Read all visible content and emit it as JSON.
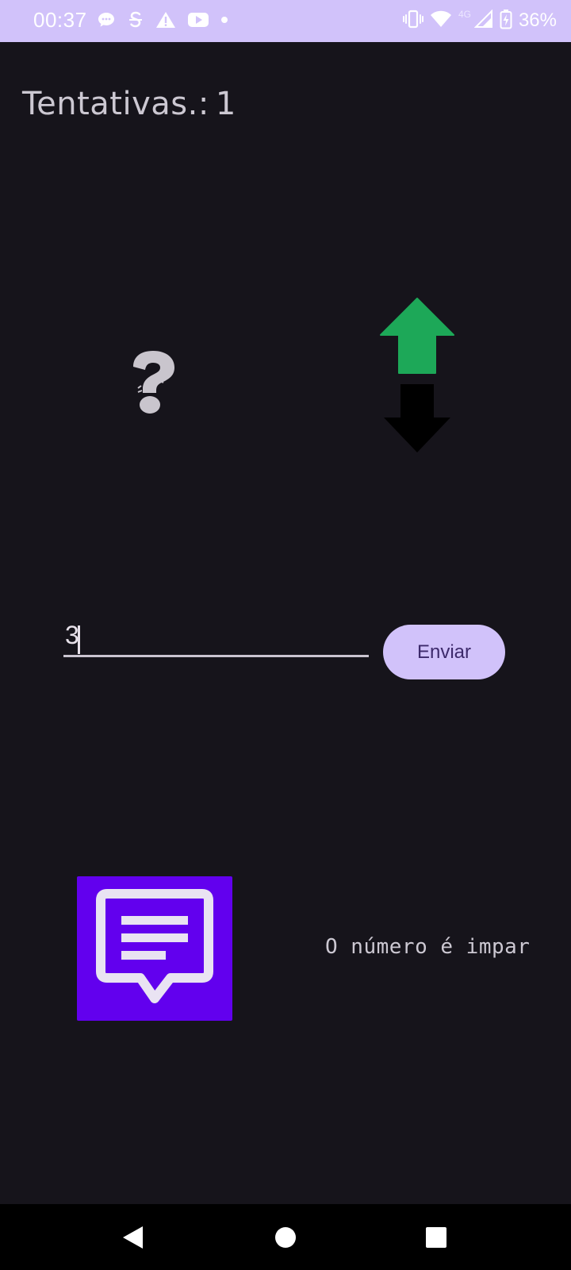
{
  "status_bar": {
    "time": "00:37",
    "network_label": "4G",
    "battery_text": "36%",
    "left_icons": [
      "chat-bubble-icon",
      "s-app-icon",
      "warning-icon",
      "youtube-icon",
      "dot-icon"
    ],
    "right_icons": [
      "vibrate-icon",
      "wifi-icon",
      "cell-signal-icon",
      "battery-icon"
    ]
  },
  "game": {
    "attempts_label": "Tentativas.:",
    "attempts_value": "1",
    "mystery_icon": "question-mark-icon",
    "hint_arrows": [
      "arrow-up-icon",
      "arrow-down-icon"
    ],
    "arrow_colors": {
      "up": "#1da858",
      "down": "#000000"
    }
  },
  "input": {
    "value": "3",
    "send_label": "Enviar"
  },
  "hint": {
    "icon": "message-icon",
    "text": "O número é impar",
    "card_color": "#6200ee"
  },
  "nav_bar": {
    "icons": [
      "back-icon",
      "home-icon",
      "recents-icon"
    ]
  },
  "colors": {
    "accent": "#d1c2fa",
    "background": "#16141b",
    "text": "#ccc8d2"
  }
}
